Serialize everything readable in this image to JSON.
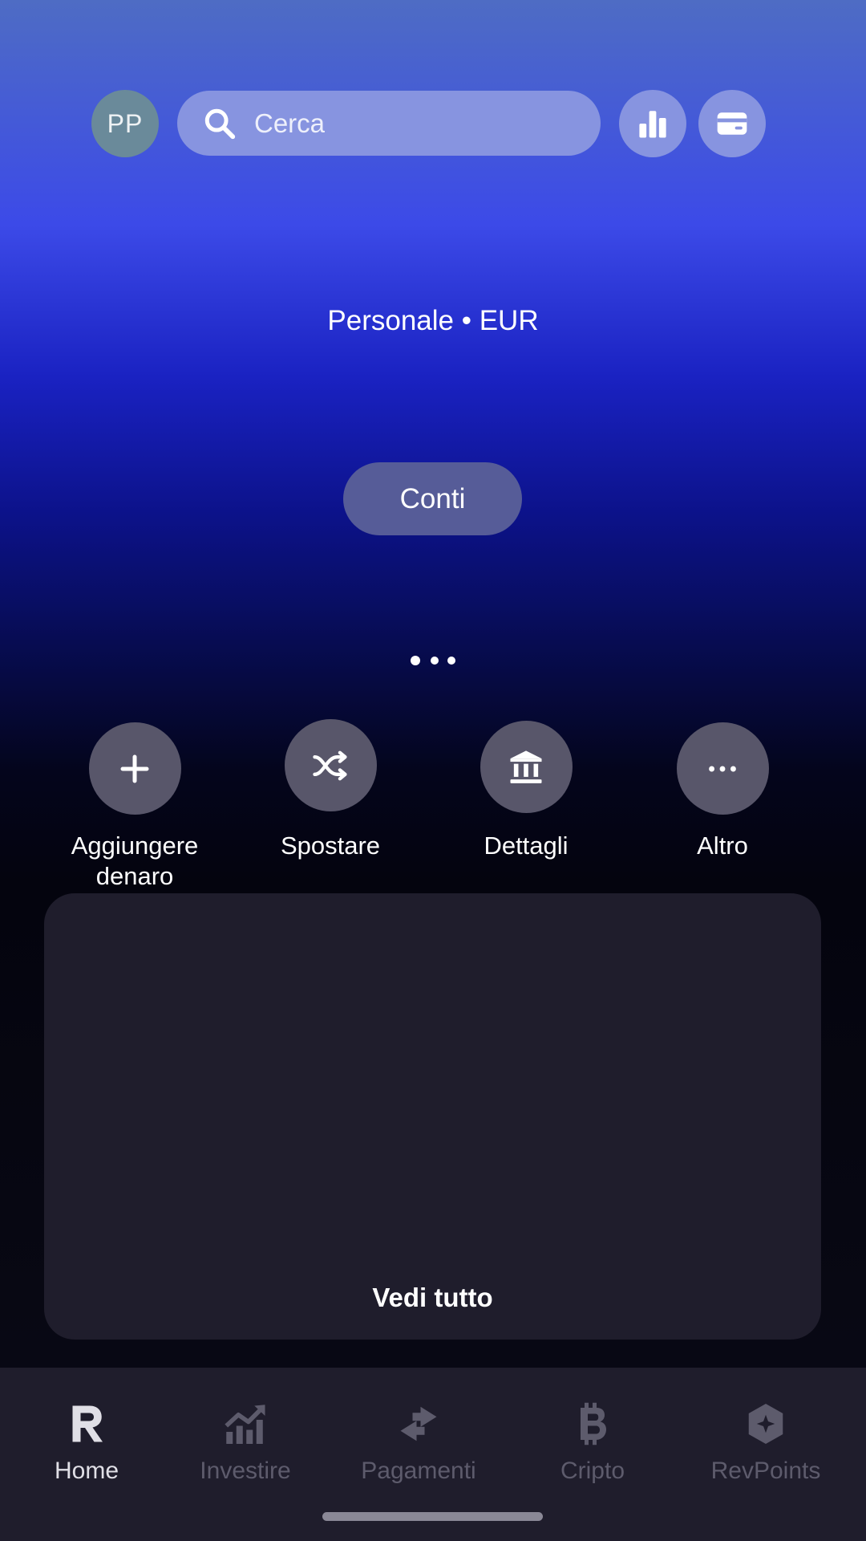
{
  "header": {
    "avatar_initials": "PP",
    "search_placeholder": "Cerca",
    "icons": [
      "search-icon",
      "bar-chart-icon",
      "card-icon"
    ]
  },
  "account": {
    "label": "Personale • EUR",
    "accounts_button": "Conti",
    "pager": {
      "count": 3,
      "active_index": 0
    }
  },
  "actions": [
    {
      "label": "Aggiungere denaro",
      "icon": "plus-icon"
    },
    {
      "label": "Spostare",
      "icon": "shuffle-icon"
    },
    {
      "label": "Dettagli",
      "icon": "bank-icon"
    },
    {
      "label": "Altro",
      "icon": "more-icon"
    }
  ],
  "transactions": {
    "see_all_label": "Vedi tutto"
  },
  "nav": {
    "items": [
      {
        "label": "Home",
        "icon": "revolut-r-icon",
        "active": true
      },
      {
        "label": "Investire",
        "icon": "invest-chart-icon",
        "active": false
      },
      {
        "label": "Pagamenti",
        "icon": "transfer-arrows-icon",
        "active": false
      },
      {
        "label": "Cripto",
        "icon": "bitcoin-icon",
        "active": false
      },
      {
        "label": "RevPoints",
        "icon": "revpoints-icon",
        "active": false
      }
    ]
  },
  "colors": {
    "accent_search": "#8794e0",
    "action_circle": "#58566a",
    "card_background": "#1f1d2c",
    "nav_inactive": "#5d5b6c",
    "nav_active": "#e0dfe6"
  }
}
